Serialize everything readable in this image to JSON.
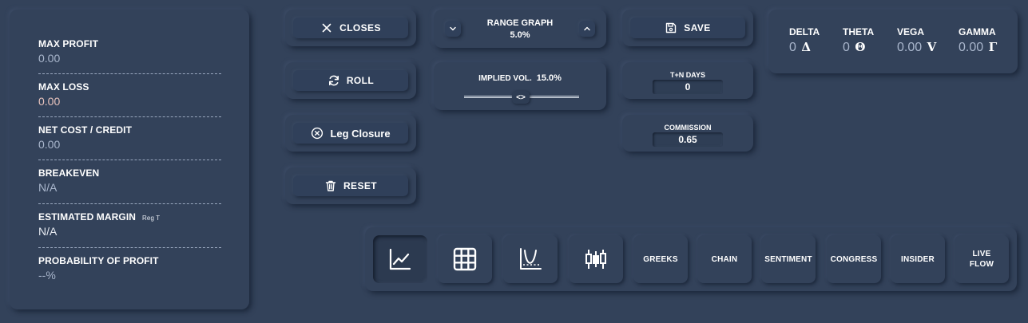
{
  "stats": [
    {
      "label": "MAX PROFIT",
      "value": "0.00",
      "tag": ""
    },
    {
      "label": "MAX LOSS",
      "value": "0.00",
      "tag": ""
    },
    {
      "label": "NET COST / CREDIT",
      "value": "0.00",
      "tag": ""
    },
    {
      "label": "BREAKEVEN",
      "value": "N/A",
      "tag": ""
    },
    {
      "label": "ESTIMATED MARGIN",
      "value": "N/A",
      "tag": "Reg T"
    },
    {
      "label": "PROBABILITY OF PROFIT",
      "value": "--%",
      "tag": ""
    }
  ],
  "actions": {
    "closes": "CLOSES",
    "roll": "ROLL",
    "leg_closure": "Leg Closure",
    "reset": "RESET",
    "save": "SAVE"
  },
  "range_graph": {
    "label": "RANGE GRAPH",
    "value": "5.0%"
  },
  "implied_vol": {
    "label": "IMPLIED VOL.",
    "value": "15.0%",
    "thumb": "<>"
  },
  "tn_days": {
    "label": "T+N DAYS",
    "value": "0"
  },
  "commission": {
    "label": "COMMISSION",
    "value": "0.65"
  },
  "greeks": [
    {
      "label": "DELTA",
      "value": "0",
      "symbol": "Δ"
    },
    {
      "label": "THETA",
      "value": "0",
      "symbol": "Θ"
    },
    {
      "label": "VEGA",
      "value": "0.00",
      "symbol": "V"
    },
    {
      "label": "GAMMA",
      "value": "0.00",
      "symbol": "Γ"
    }
  ],
  "toolbar": {
    "icons": [
      "line-chart-icon",
      "grid-table-icon",
      "payoff-curve-icon",
      "candlestick-icon"
    ],
    "greeks": "GREEKS",
    "chain": "CHAIN",
    "sentiment": "SENTIMENT",
    "congress": "CONGRESS",
    "insider": "INSIDER",
    "live_flow_1": "LIVE",
    "live_flow_2": "FLOW"
  },
  "colors": {
    "background": "#33425a",
    "muted_value": "#a9b6cc",
    "loss_value": "#e8c3bd"
  }
}
